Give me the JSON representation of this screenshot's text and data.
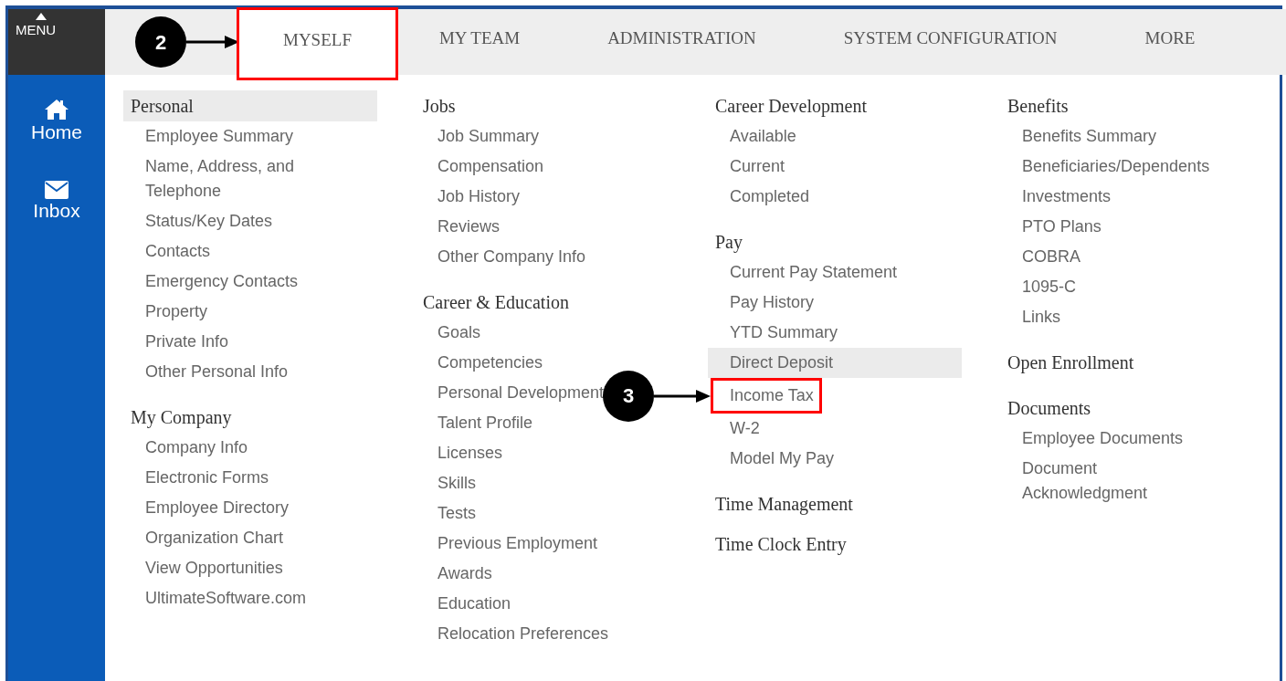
{
  "sidebar": {
    "menu_label": "MENU",
    "items": [
      {
        "kind": "home",
        "label": "Home"
      },
      {
        "kind": "inbox",
        "label": "Inbox"
      }
    ]
  },
  "tabs": [
    {
      "label": "MYSELF",
      "selected": true,
      "annotation": "2"
    },
    {
      "label": "MY TEAM",
      "selected": false
    },
    {
      "label": "ADMINISTRATION",
      "selected": false
    },
    {
      "label": "SYSTEM CONFIGURATION",
      "selected": false
    },
    {
      "label": "MORE",
      "selected": false
    }
  ],
  "columns": [
    [
      {
        "title": "Personal",
        "highlighted": true,
        "items": [
          {
            "label": "Employee Summary",
            "highlighted": false
          },
          {
            "label": "Name, Address, and Telephone",
            "highlighted": false
          },
          {
            "label": "Status/Key Dates",
            "highlighted": false
          },
          {
            "label": "Contacts",
            "highlighted": false
          },
          {
            "label": "Emergency Contacts",
            "highlighted": false
          },
          {
            "label": "Property",
            "highlighted": false
          },
          {
            "label": "Private Info",
            "highlighted": false
          },
          {
            "label": "Other Personal Info",
            "highlighted": false
          }
        ]
      },
      {
        "title": "My Company",
        "highlighted": false,
        "items": [
          {
            "label": "Company Info",
            "highlighted": false
          },
          {
            "label": "Electronic Forms",
            "highlighted": false
          },
          {
            "label": "Employee Directory",
            "highlighted": false
          },
          {
            "label": "Organization Chart",
            "highlighted": false
          },
          {
            "label": "View Opportunities",
            "highlighted": false
          },
          {
            "label": "UltimateSoftware.com",
            "highlighted": false
          }
        ]
      }
    ],
    [
      {
        "title": "Jobs",
        "highlighted": false,
        "items": [
          {
            "label": "Job Summary",
            "highlighted": false
          },
          {
            "label": "Compensation",
            "highlighted": false
          },
          {
            "label": "Job History",
            "highlighted": false
          },
          {
            "label": "Reviews",
            "highlighted": false
          },
          {
            "label": "Other Company Info",
            "highlighted": false
          }
        ]
      },
      {
        "title": "Career & Education",
        "highlighted": false,
        "items": [
          {
            "label": "Goals",
            "highlighted": false
          },
          {
            "label": "Competencies",
            "highlighted": false
          },
          {
            "label": "Personal Development",
            "highlighted": false
          },
          {
            "label": "Talent Profile",
            "highlighted": false
          },
          {
            "label": "Licenses",
            "highlighted": false
          },
          {
            "label": "Skills",
            "highlighted": false
          },
          {
            "label": "Tests",
            "highlighted": false
          },
          {
            "label": "Previous Employment",
            "highlighted": false
          },
          {
            "label": "Awards",
            "highlighted": false
          },
          {
            "label": "Education",
            "highlighted": false
          },
          {
            "label": "Relocation Preferences",
            "highlighted": false
          }
        ]
      }
    ],
    [
      {
        "title": "Career Development",
        "highlighted": false,
        "items": [
          {
            "label": "Available",
            "highlighted": false
          },
          {
            "label": "Current",
            "highlighted": false
          },
          {
            "label": "Completed",
            "highlighted": false
          }
        ]
      },
      {
        "title": "Pay",
        "highlighted": false,
        "items": [
          {
            "label": "Current Pay Statement",
            "highlighted": false
          },
          {
            "label": "Pay History",
            "highlighted": false
          },
          {
            "label": "YTD Summary",
            "highlighted": false
          },
          {
            "label": "Direct Deposit",
            "highlighted": true
          },
          {
            "label": "Income Tax",
            "highlighted": false,
            "annotation": "3"
          },
          {
            "label": "W-2",
            "highlighted": false
          },
          {
            "label": "Model My Pay",
            "highlighted": false
          }
        ]
      },
      {
        "title": "Time Management",
        "highlighted": false
      },
      {
        "title": "Time Clock Entry",
        "highlighted": false
      }
    ],
    [
      {
        "title": "Benefits",
        "highlighted": false,
        "items": [
          {
            "label": "Benefits Summary",
            "highlighted": false
          },
          {
            "label": "Beneficiaries/Dependents",
            "highlighted": false
          },
          {
            "label": "Investments",
            "highlighted": false
          },
          {
            "label": "PTO Plans",
            "highlighted": false
          },
          {
            "label": "COBRA",
            "highlighted": false
          },
          {
            "label": "1095-C",
            "highlighted": false
          },
          {
            "label": "Links",
            "highlighted": false
          }
        ]
      },
      {
        "title": "Open Enrollment",
        "highlighted": false
      },
      {
        "title": "Documents",
        "highlighted": false,
        "items": [
          {
            "label": "Employee Documents",
            "highlighted": false
          },
          {
            "label": "Document Acknowledgment",
            "highlighted": false
          }
        ]
      }
    ]
  ]
}
